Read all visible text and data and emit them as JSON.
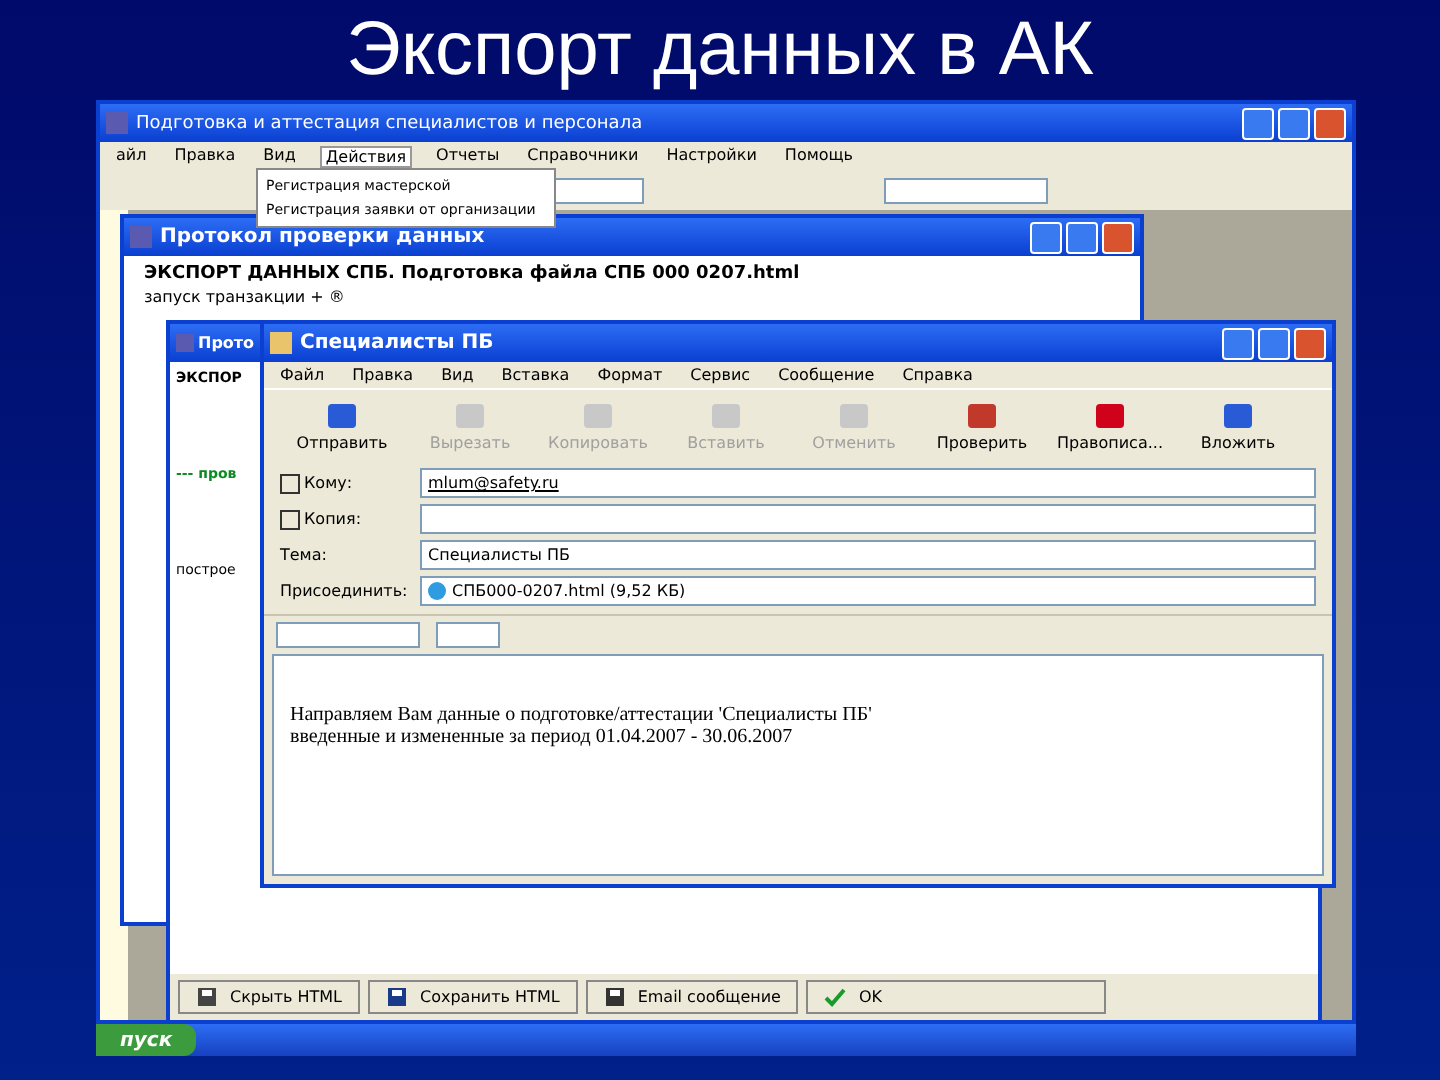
{
  "slide_title": "Экспорт данных в АК",
  "main_window": {
    "title": "Подготовка и аттестация специалистов и персонала",
    "menu": [
      {
        "label": "айл",
        "selected": false
      },
      {
        "label": "Правка",
        "selected": false
      },
      {
        "label": "Вид",
        "selected": false
      },
      {
        "label": "Действия",
        "selected": true
      },
      {
        "label": "Отчеты",
        "selected": false
      },
      {
        "label": "Справочники",
        "selected": false
      },
      {
        "label": "Настройки",
        "selected": false
      },
      {
        "label": "Помощь",
        "selected": false
      }
    ],
    "dropdown": [
      "Регистрация мастерской",
      "Регистрация заявки от организации"
    ]
  },
  "protocol_window": {
    "title": "Протокол проверки данных",
    "heading": "ЭКСПОРТ ДАННЫХ СПБ.  Подготовка файла СПБ 000 0207.html",
    "line": "запуск транзакции + ®"
  },
  "protocol_window_2": {
    "title": "Прото",
    "lines": [
      {
        "text": "ЭКСПОР",
        "kind": "bold"
      },
      {
        "text": "--- пров",
        "kind": "status"
      },
      {
        "text": "построе",
        "kind": "normal"
      }
    ],
    "buttons": [
      {
        "label": "Скрыть HTML",
        "kind": "hide"
      },
      {
        "label": "Сохранить HTML",
        "kind": "save"
      },
      {
        "label": "Email сообщение",
        "kind": "email"
      },
      {
        "label": "OK",
        "kind": "ok"
      }
    ]
  },
  "email_window": {
    "title": "Специалисты ПБ",
    "menu": [
      "Файл",
      "Правка",
      "Вид",
      "Вставка",
      "Формат",
      "Сервис",
      "Сообщение",
      "Справка"
    ],
    "toolbar": [
      {
        "label": "Отправить",
        "kind": "send",
        "disabled": false
      },
      {
        "label": "Вырезать",
        "kind": "cut",
        "disabled": true
      },
      {
        "label": "Копировать",
        "kind": "copy",
        "disabled": true
      },
      {
        "label": "Вставить",
        "kind": "paste",
        "disabled": true
      },
      {
        "label": "Отменить",
        "kind": "undo",
        "disabled": true
      },
      {
        "label": "Проверить",
        "kind": "check",
        "disabled": false
      },
      {
        "label": "Правописа...",
        "kind": "spell",
        "disabled": false
      },
      {
        "label": "Вложить",
        "kind": "attach",
        "disabled": false
      }
    ],
    "fields": [
      {
        "label": "Кому:",
        "kind": "address",
        "value": "mlum@safety.ru"
      },
      {
        "label": "Копия:",
        "kind": "address"
      },
      {
        "label": "Тема:",
        "kind": "plain",
        "value": "Специалисты ПБ"
      },
      {
        "label": "Присоединить:",
        "kind": "attachment",
        "value": "СПБ000-0207.html (9,52 КБ)"
      }
    ],
    "body": [
      "Направляем Вам данные о подготовке/аттестации 'Специалисты ПБ'",
      "введенные и измененные за период 01.04.2007 - 30.06.2007"
    ]
  },
  "taskbar": {
    "start": "пуск"
  }
}
